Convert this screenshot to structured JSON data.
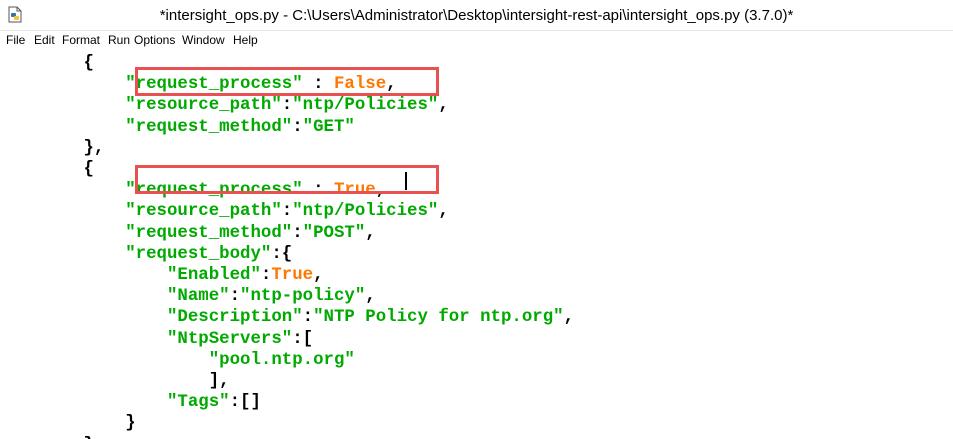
{
  "window": {
    "title": "*intersight_ops.py - C:\\Users\\Administrator\\Desktop\\intersight-rest-api\\intersight_ops.py (3.7.0)*",
    "icon": "python-file-icon"
  },
  "menu": [
    {
      "key": "file",
      "label": "File"
    },
    {
      "key": "edit",
      "label": "Edit"
    },
    {
      "key": "format",
      "label": "Format"
    },
    {
      "key": "run",
      "label": "Run"
    },
    {
      "key": "options",
      "label": "Options"
    },
    {
      "key": "window",
      "label": "Window"
    },
    {
      "key": "help",
      "label": "Help"
    }
  ],
  "colors": {
    "string": "#00aa00",
    "keyword": "#ff7700",
    "highlight_box": "#e8514f"
  },
  "code_lines": [
    [
      {
        "t": "punct",
        "v": "        {"
      }
    ],
    [
      {
        "t": "punct",
        "v": "            "
      },
      {
        "t": "str",
        "v": "\"request_process\""
      },
      {
        "t": "punct",
        "v": " : "
      },
      {
        "t": "kw",
        "v": "False"
      },
      {
        "t": "punct",
        "v": ","
      }
    ],
    [
      {
        "t": "punct",
        "v": "            "
      },
      {
        "t": "str",
        "v": "\"resource_path\""
      },
      {
        "t": "punct",
        "v": ":"
      },
      {
        "t": "str",
        "v": "\"ntp/Policies\""
      },
      {
        "t": "punct",
        "v": ","
      }
    ],
    [
      {
        "t": "punct",
        "v": "            "
      },
      {
        "t": "str",
        "v": "\"request_method\""
      },
      {
        "t": "punct",
        "v": ":"
      },
      {
        "t": "str",
        "v": "\"GET\""
      }
    ],
    [
      {
        "t": "punct",
        "v": "        },"
      }
    ],
    [
      {
        "t": "punct",
        "v": "        {"
      }
    ],
    [
      {
        "t": "punct",
        "v": "            "
      },
      {
        "t": "str",
        "v": "\"request_process\""
      },
      {
        "t": "punct",
        "v": " : "
      },
      {
        "t": "kw",
        "v": "True"
      },
      {
        "t": "punct",
        "v": ","
      }
    ],
    [
      {
        "t": "punct",
        "v": "            "
      },
      {
        "t": "str",
        "v": "\"resource_path\""
      },
      {
        "t": "punct",
        "v": ":"
      },
      {
        "t": "str",
        "v": "\"ntp/Policies\""
      },
      {
        "t": "punct",
        "v": ","
      }
    ],
    [
      {
        "t": "punct",
        "v": "            "
      },
      {
        "t": "str",
        "v": "\"request_method\""
      },
      {
        "t": "punct",
        "v": ":"
      },
      {
        "t": "str",
        "v": "\"POST\""
      },
      {
        "t": "punct",
        "v": ","
      }
    ],
    [
      {
        "t": "punct",
        "v": "            "
      },
      {
        "t": "str",
        "v": "\"request_body\""
      },
      {
        "t": "punct",
        "v": ":{"
      }
    ],
    [
      {
        "t": "punct",
        "v": "                "
      },
      {
        "t": "str",
        "v": "\"Enabled\""
      },
      {
        "t": "punct",
        "v": ":"
      },
      {
        "t": "kw",
        "v": "True"
      },
      {
        "t": "punct",
        "v": ","
      }
    ],
    [
      {
        "t": "punct",
        "v": "                "
      },
      {
        "t": "str",
        "v": "\"Name\""
      },
      {
        "t": "punct",
        "v": ":"
      },
      {
        "t": "str",
        "v": "\"ntp-policy\""
      },
      {
        "t": "punct",
        "v": ","
      }
    ],
    [
      {
        "t": "punct",
        "v": "                "
      },
      {
        "t": "str",
        "v": "\"Description\""
      },
      {
        "t": "punct",
        "v": ":"
      },
      {
        "t": "str",
        "v": "\"NTP Policy for ntp.org\""
      },
      {
        "t": "punct",
        "v": ","
      }
    ],
    [
      {
        "t": "punct",
        "v": "                "
      },
      {
        "t": "str",
        "v": "\"NtpServers\""
      },
      {
        "t": "punct",
        "v": ":["
      }
    ],
    [
      {
        "t": "punct",
        "v": "                    "
      },
      {
        "t": "str",
        "v": "\"pool.ntp.org\""
      }
    ],
    [
      {
        "t": "punct",
        "v": "                    ],"
      }
    ],
    [
      {
        "t": "punct",
        "v": "                "
      },
      {
        "t": "str",
        "v": "\"Tags\""
      },
      {
        "t": "punct",
        "v": ":[]"
      }
    ],
    [
      {
        "t": "punct",
        "v": "            }"
      }
    ],
    [
      {
        "t": "punct",
        "v": "        },"
      }
    ]
  ]
}
